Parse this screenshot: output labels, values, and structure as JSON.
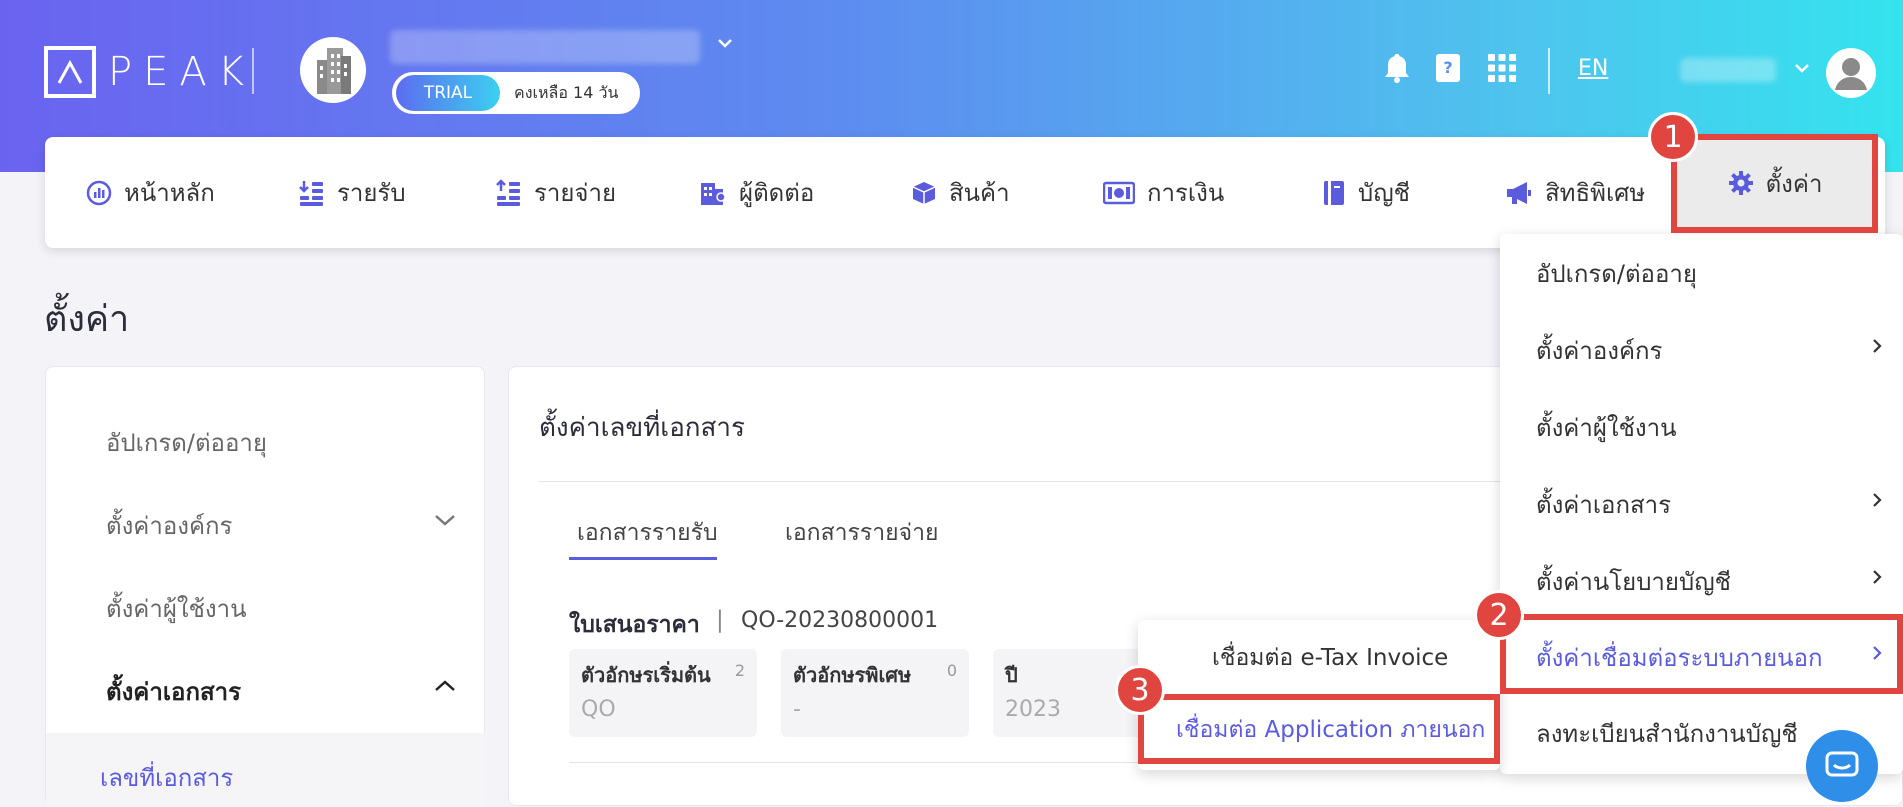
{
  "brand": {
    "logo_text": "PEAK"
  },
  "header": {
    "trial_label": "TRIAL",
    "trial_remaining": "คงเหลือ 14 วัน",
    "lang": "EN"
  },
  "nav": [
    {
      "label": "หน้าหลัก",
      "icon": "dashboard-icon"
    },
    {
      "label": "รายรับ",
      "icon": "income-icon"
    },
    {
      "label": "รายจ่าย",
      "icon": "expense-icon"
    },
    {
      "label": "ผู้ติดต่อ",
      "icon": "contacts-icon"
    },
    {
      "label": "สินค้า",
      "icon": "product-box-icon"
    },
    {
      "label": "การเงิน",
      "icon": "money-icon"
    },
    {
      "label": "บัญชี",
      "icon": "account-book-icon"
    },
    {
      "label": "สิทธิพิเศษ",
      "icon": "megaphone-icon"
    },
    {
      "label": "ตั้งค่า",
      "icon": "gear-icon"
    }
  ],
  "page": {
    "title": "ตั้งค่า"
  },
  "left_menu": {
    "items": [
      {
        "label": "อัปเกรด/ต่ออายุ"
      },
      {
        "label": "ตั้งค่าองค์กร"
      },
      {
        "label": "ตั้งค่าผู้ใช้งาน"
      },
      {
        "label": "ตั้งค่าเอกสาร"
      }
    ],
    "sub_item": "เลขที่เอกสาร"
  },
  "main": {
    "title": "ตั้งค่าเลขที่เอกสาร",
    "tabs": [
      {
        "label": "เอกสารรายรับ"
      },
      {
        "label": "เอกสารรายจ่าย"
      }
    ],
    "doc_type": "ใบเสนอราคา",
    "doc_sep": "|",
    "doc_code": "QO-20230800001",
    "fields": [
      {
        "label": "ตัวอักษรเริ่มต้น",
        "count": "2",
        "value": "QO"
      },
      {
        "label": "ตัวอักษรพิเศษ",
        "count": "0",
        "value": "-"
      },
      {
        "label": "ปี",
        "count": "",
        "value": "2023"
      }
    ]
  },
  "dropdown": {
    "items": [
      {
        "label": "อัปเกรด/ต่ออายุ"
      },
      {
        "label": "ตั้งค่าองค์กร"
      },
      {
        "label": "ตั้งค่าผู้ใช้งาน"
      },
      {
        "label": "ตั้งค่าเอกสาร"
      },
      {
        "label": "ตั้งค่านโยบายบัญชี"
      },
      {
        "label": "ตั้งค่าเชื่อมต่อระบบภายนอก"
      },
      {
        "label": "ลงทะเบียนสำนักงานบัญชี"
      }
    ]
  },
  "submenu": {
    "items": [
      {
        "label": "เชื่อมต่อ e-Tax Invoice"
      },
      {
        "label": "เชื่อมต่อ Application ภายนอก"
      }
    ]
  },
  "callouts": [
    "1",
    "2",
    "3"
  ],
  "colors": {
    "accent": "#5b5bde",
    "callout_red": "#e0463f"
  }
}
